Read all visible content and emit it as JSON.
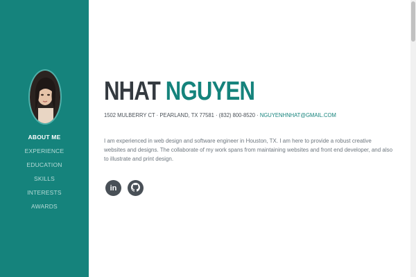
{
  "profile": {
    "first_name": "NHAT",
    "last_name": "NGUYEN",
    "address": "1502 MULBERRY CT · PEARLAND, TX 77581 · (832) 800-8520 ·",
    "email": "NGUYENHNHAT@GMAIL.COM",
    "bio": "I am experienced in web design and software engineer in Houston, TX. I am here to provide a robust creative websites and designs. The collaborate of my work spans from maintaining websites and front end developer, and also to illustrate and print design."
  },
  "nav": {
    "items": [
      {
        "label": "About Me",
        "active": true
      },
      {
        "label": "Experience",
        "active": false
      },
      {
        "label": "Education",
        "active": false
      },
      {
        "label": "Skills",
        "active": false
      },
      {
        "label": "Interests",
        "active": false
      },
      {
        "label": "Awards",
        "active": false
      }
    ]
  },
  "social": {
    "linkedin_glyph": "in",
    "icons": [
      "linkedin-icon",
      "github-icon"
    ]
  },
  "colors": {
    "sidebar": "#15837c",
    "accent": "#15837c",
    "heading": "#343a40",
    "social_bg": "#495057"
  }
}
